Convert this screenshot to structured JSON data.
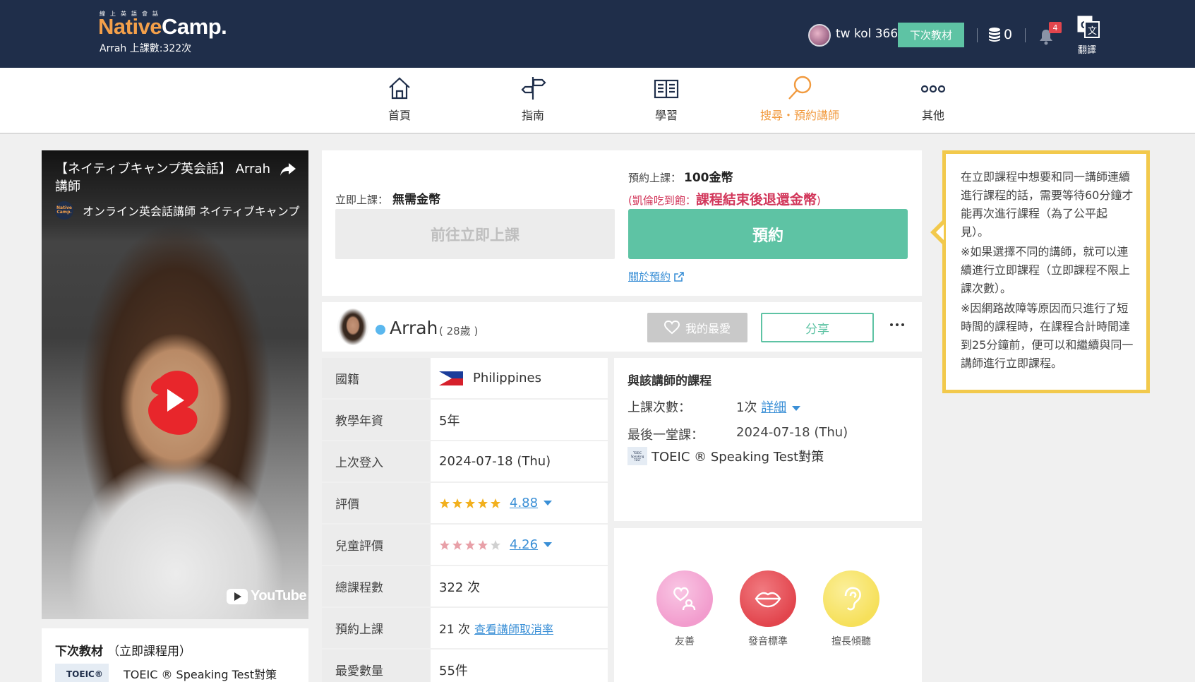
{
  "header": {
    "logo_tagline": "線上英語會話",
    "logo_native": "Native",
    "logo_camp": "Camp.",
    "teacher_lessons": "Arrah 上課數:322次",
    "user_name": "tw kol 366",
    "next_material_button": "下次教材",
    "coin_count": "0",
    "notification_count": "4",
    "translate_label": "翻譯"
  },
  "nav": {
    "items": [
      {
        "label": "首頁",
        "icon": "home-icon"
      },
      {
        "label": "指南",
        "icon": "signpost-icon"
      },
      {
        "label": "學習",
        "icon": "book-icon"
      },
      {
        "label": "搜尋・預約講師",
        "icon": "search-icon",
        "active": true
      },
      {
        "label": "其他",
        "icon": "more-icon"
      }
    ]
  },
  "video": {
    "title": "【ネイティブキャンプ英会話】 Arrah講師",
    "channel": "オンライン英会話講師 ネイティブキャンプ",
    "channel_logo": "Native Camp.",
    "youtube_label": "YouTube"
  },
  "next_material": {
    "title": "下次教材",
    "subtitle": "（立即課程用）",
    "thumb_label": "TOEIC®",
    "name": "TOEIC ® Speaking Test對策"
  },
  "reserve": {
    "instant_label": "立即上課：",
    "instant_cost": "無需金幣",
    "instant_button": "前往立即上課",
    "reserve_label": "預約上課：",
    "reserve_cost": "100金幣",
    "refund_prefix": "(凱倫吃到飽：",
    "refund_text": "課程結束後退還金幣",
    "refund_suffix": ")",
    "reserve_button": "預約",
    "about_link": "關於預約"
  },
  "teacher": {
    "name": "Arrah",
    "age": "( 28歲 )",
    "favorite_button": "我的最愛",
    "share_button": "分享"
  },
  "info": {
    "nationality_label": "國籍",
    "nationality": "Philippines",
    "experience_label": "教學年資",
    "experience": "5年",
    "last_login_label": "上次登入",
    "last_login": "2024-07-18 (Thu)",
    "rating_label": "評價",
    "rating": "4.88",
    "kids_rating_label": "兒童評價",
    "kids_rating": "4.26",
    "total_lessons_label": "總課程數",
    "total_lessons": "322 次",
    "reservations_label": "預約上課",
    "reservations": "21 次",
    "cancel_rate_link": "查看講師取消率",
    "favorites_label": "最愛數量",
    "favorites": "55件"
  },
  "courses": {
    "title": "與該講師的課程",
    "count_label": "上課次數：",
    "count_value": "1次",
    "detail_link": "詳細",
    "last_label": "最後一堂課：",
    "last_value": "2024-07-18 (Thu)",
    "material_thumb": "TOEIC Speaking TEST",
    "material_name": "TOEIC ® Speaking Test對策"
  },
  "tags": [
    {
      "label": "友善",
      "icon": "friendly-icon",
      "color": "#f29ccd"
    },
    {
      "label": "發音標準",
      "icon": "lips-icon",
      "color": "#e2454d"
    },
    {
      "label": "擅長傾聽",
      "icon": "ear-icon",
      "color": "#f6e05a"
    }
  ],
  "notice": {
    "p1": "在立即課程中想要和同一講師連續進行課程的話，需要等待60分鐘才能再次進行課程（為了公平起見）。",
    "p2": "※如果選擇不同的講師，就可以連續進行立即課程（立即課程不限上課次數）。",
    "p3": "※因網路故障等原因而只進行了短時間的課程時，在課程合計時間達到25分鐘前，便可以和繼續與同一講師進行立即課程。"
  },
  "colors": {
    "header_bg": "#1f2e4a",
    "accent_green": "#5ec3a4",
    "accent_orange": "#f19a3e",
    "alert_red": "#d2365a",
    "notice_border": "#f2c94c",
    "link_blue": "#3a8fd6"
  }
}
